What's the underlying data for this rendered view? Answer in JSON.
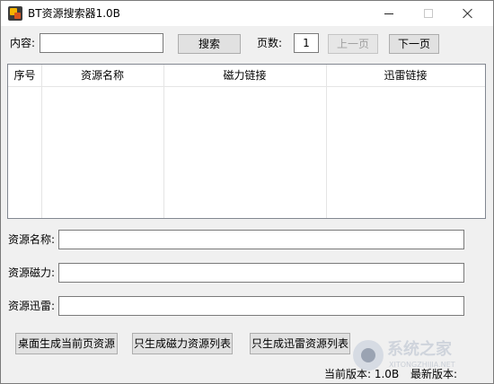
{
  "window": {
    "title": "BT资源搜索器1.0B"
  },
  "search": {
    "content_label": "内容:",
    "content_value": "",
    "search_button": "搜索",
    "page_label": "页数:",
    "page_value": "1",
    "prev_button": "上一页",
    "next_button": "下一页"
  },
  "table": {
    "columns": [
      "序号",
      "资源名称",
      "磁力链接",
      "迅雷链接"
    ],
    "rows": []
  },
  "details": {
    "name_label": "资源名称:",
    "name_value": "",
    "magnet_label": "资源磁力:",
    "magnet_value": "",
    "thunder_label": "资源迅雷:",
    "thunder_value": ""
  },
  "actions": {
    "desktop_button": "桌面生成当前页资源",
    "magnet_list_button": "只生成磁力资源列表",
    "thunder_list_button": "只生成迅雷资源列表"
  },
  "status": {
    "current_version": "当前版本: 1.0B",
    "latest_version": "最新版本:"
  },
  "watermark": {
    "text": "系统之家",
    "url": "XITONGZHIJIA.NET"
  }
}
